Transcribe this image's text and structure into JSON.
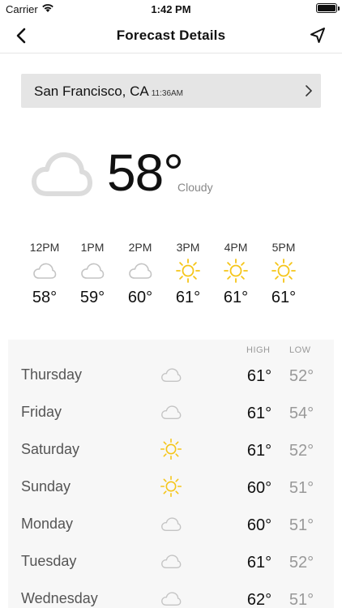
{
  "status_bar": {
    "carrier": "Carrier",
    "time": "1:42 PM"
  },
  "nav": {
    "title": "Forecast Details"
  },
  "location": {
    "name": "San Francisco, CA",
    "time": "11:36AM"
  },
  "current": {
    "temperature": "58°",
    "condition": "Cloudy",
    "icon": "cloud-icon"
  },
  "hourly": [
    {
      "time": "12PM",
      "icon": "cloud-icon",
      "temp": "58°"
    },
    {
      "time": "1PM",
      "icon": "cloud-icon",
      "temp": "59°"
    },
    {
      "time": "2PM",
      "icon": "cloud-icon",
      "temp": "60°"
    },
    {
      "time": "3PM",
      "icon": "sun-icon",
      "temp": "61°"
    },
    {
      "time": "4PM",
      "icon": "sun-icon",
      "temp": "61°"
    },
    {
      "time": "5PM",
      "icon": "sun-icon",
      "temp": "61°"
    }
  ],
  "daily": {
    "high_label": "HIGH",
    "low_label": "LOW",
    "days": [
      {
        "day": "Thursday",
        "icon": "cloud-icon",
        "high": "61°",
        "low": "52°"
      },
      {
        "day": "Friday",
        "icon": "cloud-icon",
        "high": "61°",
        "low": "54°"
      },
      {
        "day": "Saturday",
        "icon": "sun-icon",
        "high": "61°",
        "low": "52°"
      },
      {
        "day": "Sunday",
        "icon": "sun-icon",
        "high": "60°",
        "low": "51°"
      },
      {
        "day": "Monday",
        "icon": "cloud-icon",
        "high": "60°",
        "low": "51°"
      },
      {
        "day": "Tuesday",
        "icon": "cloud-icon",
        "high": "61°",
        "low": "52°"
      },
      {
        "day": "Wednesday",
        "icon": "cloud-icon",
        "high": "62°",
        "low": "51°"
      }
    ]
  },
  "colors": {
    "sun": "#f5c518",
    "cloud_outline": "#c4c4c4",
    "cloud_large": "#dcdcdc",
    "section_bg": "#f7f7f7",
    "location_bar_bg": "#e5e5e5"
  }
}
